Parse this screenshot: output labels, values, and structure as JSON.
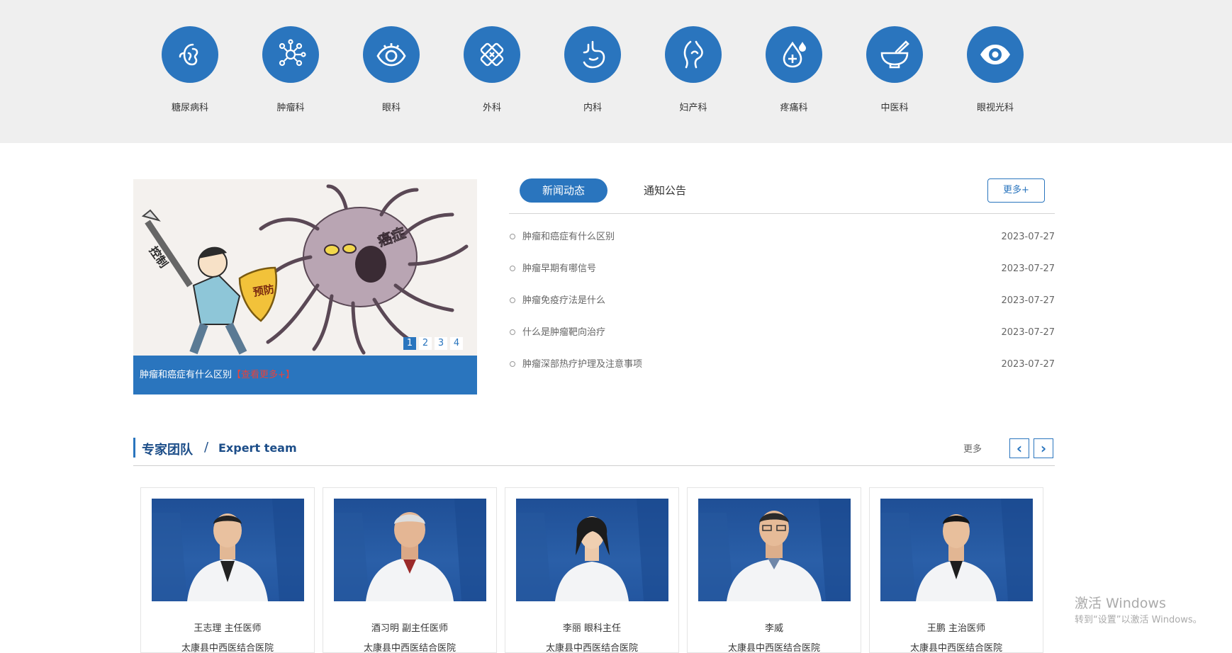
{
  "departments": [
    {
      "label": "糖尿病科",
      "icon": "kidney-icon"
    },
    {
      "label": "肿瘤科",
      "icon": "cells-icon"
    },
    {
      "label": "眼科",
      "icon": "eye-icon"
    },
    {
      "label": "外科",
      "icon": "bandage-icon"
    },
    {
      "label": "内科",
      "icon": "stomach-icon"
    },
    {
      "label": "妇产科",
      "icon": "uterus-icon"
    },
    {
      "label": "疼痛科",
      "icon": "drop-plus-icon"
    },
    {
      "label": "中医科",
      "icon": "mortar-icon"
    },
    {
      "label": "眼视光科",
      "icon": "eye-filled-icon"
    }
  ],
  "slider": {
    "dots": [
      "1",
      "2",
      "3",
      "4"
    ],
    "active_dot": 0,
    "caption": "肿瘤和癌症有什么区别",
    "caption_more": "【查看更多+】"
  },
  "news": {
    "tabs": [
      "新闻动态",
      "通知公告"
    ],
    "active_tab": 0,
    "more_label": "更多+",
    "items": [
      {
        "title": "肿瘤和癌症有什么区别",
        "date": "2023-07-27"
      },
      {
        "title": "肿瘤早期有哪信号",
        "date": "2023-07-27"
      },
      {
        "title": "肿瘤免疫疗法是什么",
        "date": "2023-07-27"
      },
      {
        "title": "什么是肿瘤靶向治疗",
        "date": "2023-07-27"
      },
      {
        "title": "肿瘤深部热疗护理及注意事项",
        "date": "2023-07-27"
      }
    ]
  },
  "experts": {
    "title": "专家团队",
    "separator": "/",
    "title_en": "Expert team",
    "more_label": "更多",
    "prev_symbol": "‹",
    "next_symbol": "›",
    "cards": [
      {
        "name": "王志理  主任医师",
        "hospital": "太康县中西医结合医院"
      },
      {
        "name": "酒习明  副主任医师",
        "hospital": "太康县中西医结合医院"
      },
      {
        "name": "李丽  眼科主任",
        "hospital": "太康县中西医结合医院"
      },
      {
        "name": "李威",
        "hospital": "太康县中西医结合医院"
      },
      {
        "name": "王鹏  主治医师",
        "hospital": "太康县中西医结合医院"
      }
    ]
  },
  "watermark": {
    "line1": "激活 Windows",
    "line2": "转到“设置”以激活 Windows。"
  },
  "colors": {
    "brand_blue": "#2a75be",
    "accent_red": "#e8423b",
    "band_gray": "#efefef"
  }
}
